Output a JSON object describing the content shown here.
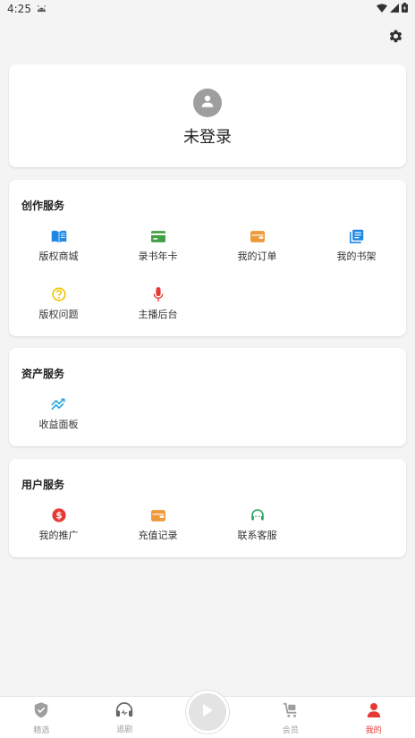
{
  "status_bar": {
    "time": "4:25"
  },
  "login": {
    "text": "未登录"
  },
  "sections": {
    "create": {
      "title": "创作服务",
      "items": [
        {
          "label": "版权商城",
          "icon": "book-open-icon",
          "color": "#1e88e5"
        },
        {
          "label": "录书年卡",
          "icon": "card-icon",
          "color": "#43a047"
        },
        {
          "label": "我的订单",
          "icon": "wallet-icon",
          "color": "#ef9a3a"
        },
        {
          "label": "我的书架",
          "icon": "library-icon",
          "color": "#1e88e5"
        },
        {
          "label": "版权问题",
          "icon": "question-icon",
          "color": "#f2c200"
        },
        {
          "label": "主播后台",
          "icon": "microphone-icon",
          "color": "#e53935"
        }
      ]
    },
    "asset": {
      "title": "资产服务",
      "items": [
        {
          "label": "收益面板",
          "icon": "trend-icon",
          "color": "#29a3e0"
        }
      ]
    },
    "user": {
      "title": "用户服务",
      "items": [
        {
          "label": "我的推广",
          "icon": "dollar-icon",
          "color": "#e53935"
        },
        {
          "label": "充值记录",
          "icon": "wallet-icon",
          "color": "#ef9a3a"
        },
        {
          "label": "联系客服",
          "icon": "headset-icon",
          "color": "#26a65b"
        }
      ]
    }
  },
  "bottom_nav": {
    "items": [
      {
        "label": "精选",
        "icon": "shield-check-icon"
      },
      {
        "label": "追剧",
        "icon": "headphones-icon"
      },
      {
        "label": "会员",
        "icon": "cart-icon"
      },
      {
        "label": "我的",
        "icon": "person-icon",
        "active": true
      }
    ],
    "active_color": "#e53935",
    "inactive_color": "#9e9e9e"
  }
}
